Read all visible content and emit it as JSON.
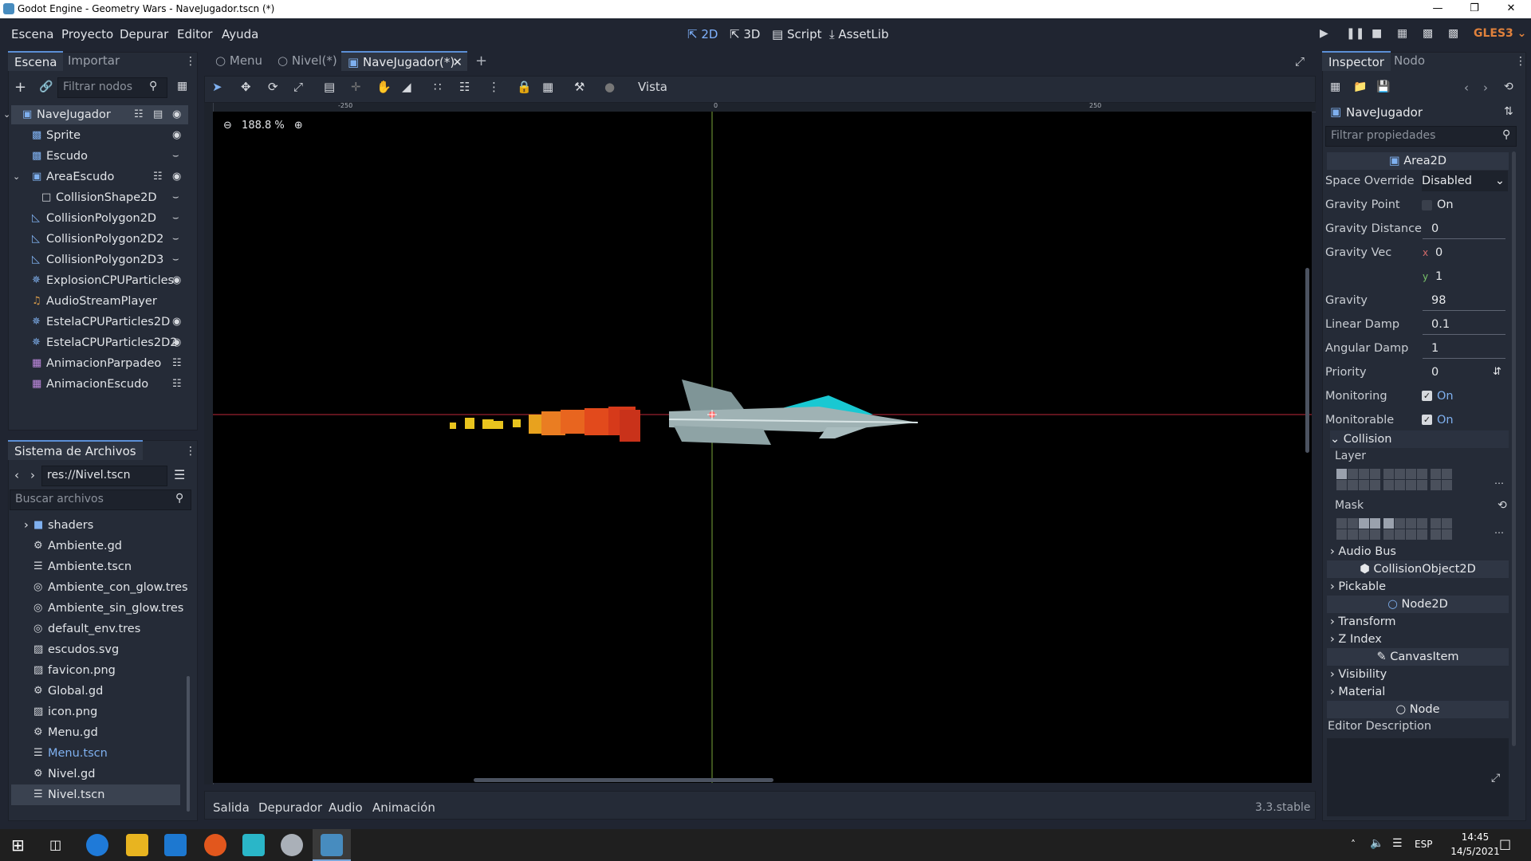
{
  "window": {
    "title": "Godot Engine - Geometry Wars - NaveJugador.tscn (*)"
  },
  "menu": [
    "Escena",
    "Proyecto",
    "Depurar",
    "Editor",
    "Ayuda"
  ],
  "modes": {
    "m2d": "2D",
    "m3d": "3D",
    "script": "Script",
    "assetlib": "AssetLib"
  },
  "renderer": "GLES3",
  "scene_dock": {
    "tabs": [
      "Escena",
      "Importar"
    ],
    "filter_placeholder": "Filtrar nodos",
    "nodes": [
      {
        "label": "NaveJugador",
        "icon": "area2d-icon"
      },
      {
        "label": "Sprite",
        "icon": "sprite-icon"
      },
      {
        "label": "Escudo",
        "icon": "sprite-icon"
      },
      {
        "label": "AreaEscudo",
        "icon": "area2d-icon"
      },
      {
        "label": "CollisionShape2D",
        "icon": "collision-shape-icon"
      },
      {
        "label": "CollisionPolygon2D",
        "icon": "collision-polygon-icon"
      },
      {
        "label": "CollisionPolygon2D2",
        "icon": "collision-polygon-icon"
      },
      {
        "label": "CollisionPolygon2D3",
        "icon": "collision-polygon-icon"
      },
      {
        "label": "ExplosionCPUParticles",
        "icon": "particles-icon"
      },
      {
        "label": "AudioStreamPlayer",
        "icon": "audio-icon"
      },
      {
        "label": "EstelaCPUParticles2D",
        "icon": "particles-icon"
      },
      {
        "label": "EstelaCPUParticles2D2",
        "icon": "particles-icon"
      },
      {
        "label": "AnimacionParpadeo",
        "icon": "animation-icon"
      },
      {
        "label": "AnimacionEscudo",
        "icon": "animation-icon"
      }
    ]
  },
  "filesystem": {
    "title": "Sistema de Archivos",
    "path": "res://Nivel.tscn",
    "search_placeholder": "Buscar archivos",
    "files": [
      {
        "label": "shaders",
        "icon": "folder-icon"
      },
      {
        "label": "Ambiente.gd",
        "icon": "gear-icon"
      },
      {
        "label": "Ambiente.tscn",
        "icon": "scene-icon"
      },
      {
        "label": "Ambiente_con_glow.tres",
        "icon": "globe-icon"
      },
      {
        "label": "Ambiente_sin_glow.tres",
        "icon": "globe-icon"
      },
      {
        "label": "default_env.tres",
        "icon": "globe-icon"
      },
      {
        "label": "escudos.svg",
        "icon": "image-icon"
      },
      {
        "label": "favicon.png",
        "icon": "image-icon"
      },
      {
        "label": "Global.gd",
        "icon": "gear-icon"
      },
      {
        "label": "icon.png",
        "icon": "image-icon"
      },
      {
        "label": "Menu.gd",
        "icon": "gear-icon"
      },
      {
        "label": "Menu.tscn",
        "icon": "scene-icon"
      },
      {
        "label": "Nivel.gd",
        "icon": "gear-icon"
      },
      {
        "label": "Nivel.tscn",
        "icon": "scene-icon"
      }
    ]
  },
  "editor_tabs": [
    "Menu",
    "Nivel(*)",
    "NaveJugador(*)"
  ],
  "viewport": {
    "zoom": "188.8 %",
    "view_menu": "Vista",
    "ruler_labels": [
      "-250",
      "0",
      "250"
    ]
  },
  "bottom_panel": {
    "tabs": [
      "Salida",
      "Depurador",
      "Audio",
      "Animación"
    ],
    "version": "3.3.stable"
  },
  "inspector": {
    "tabs": [
      "Inspector",
      "Nodo"
    ],
    "object_name": "NaveJugador",
    "filter_placeholder": "Filtrar propiedades",
    "class_header": "Area2D",
    "props": {
      "space_override": {
        "label": "Space Override",
        "value": "Disabled"
      },
      "gravity_point": {
        "label": "Gravity Point",
        "value": "On"
      },
      "gravity_distance": {
        "label": "Gravity Distance",
        "value": "0"
      },
      "gravity_vec": {
        "label": "Gravity Vec",
        "x": "0",
        "y": "1"
      },
      "gravity": {
        "label": "Gravity",
        "value": "98"
      },
      "linear_damp": {
        "label": "Linear Damp",
        "value": "0.1"
      },
      "angular_damp": {
        "label": "Angular Damp",
        "value": "1"
      },
      "priority": {
        "label": "Priority",
        "value": "0"
      },
      "monitoring": {
        "label": "Monitoring",
        "value": "On"
      },
      "monitorable": {
        "label": "Monitorable",
        "value": "On"
      }
    },
    "collision": {
      "title": "Collision",
      "layer": "Layer",
      "mask": "Mask"
    },
    "sections": {
      "audio_bus": "Audio Bus",
      "collision_object": "CollisionObject2D",
      "pickable": "Pickable",
      "node2d": "Node2D",
      "transform": "Transform",
      "z_index": "Z Index",
      "canvas_item": "CanvasItem",
      "visibility": "Visibility",
      "material": "Material",
      "node": "Node",
      "editor_description": "Editor Description"
    }
  },
  "taskbar": {
    "lang": "ESP",
    "time": "14:45",
    "date": "14/5/2021"
  },
  "colors": {
    "accent": "#5b8fd6",
    "ship_cyan": "#19c8d2",
    "flame_red": "#d63a1a",
    "flame_yellow": "#e8c41e"
  }
}
